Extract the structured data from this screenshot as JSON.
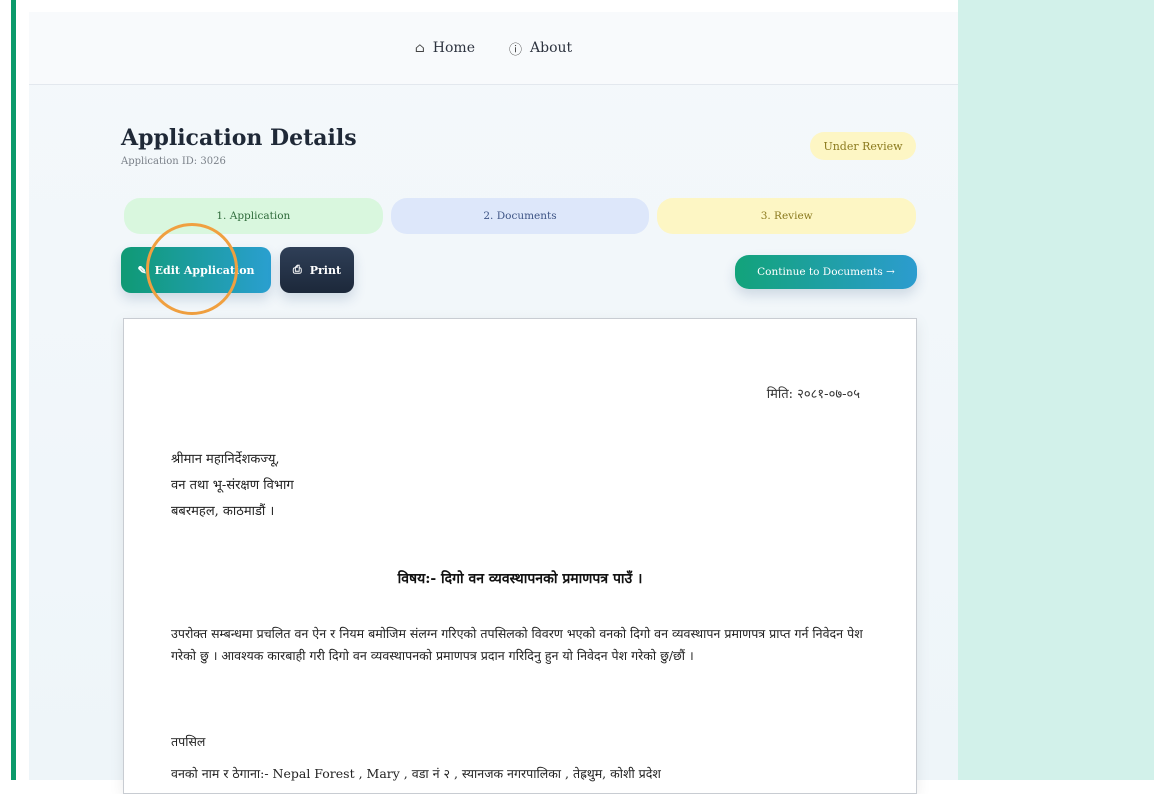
{
  "nav": {
    "home_icon": "home-icon",
    "home_label": "Home",
    "about_icon": "info-icon",
    "about_label": "About"
  },
  "header": {
    "title": "Application Details",
    "app_id": "Application ID: 3026",
    "status": "Under Review"
  },
  "steps": [
    {
      "label": "1. Application"
    },
    {
      "label": "2. Documents"
    },
    {
      "label": "3. Review"
    }
  ],
  "actions": {
    "edit_label": "Edit Application",
    "print_label": "Print",
    "continue_label": "Continue to Documents →"
  },
  "document": {
    "date": "मिति: २०८१-०७-०५",
    "address_lines": [
      "श्रीमान महानिर्देशकज्यू,",
      "वन तथा भू-संरक्षण विभाग",
      "बबरमहल, काठमाडौं ।"
    ],
    "subject": "विषय:- दिगो वन व्यवस्थापनको प्रमाणपत्र पाउँ ।",
    "body": "उपरोक्त सम्बन्धमा प्रचलित वन ऐन र नियम बमोजिम संलग्न गरिएको तपसिलको विवरण भएको वनको दिगो वन व्यवस्थापन प्रमाणपत्र प्राप्त गर्न निवेदन पेश गरेको छु । आवश्यक कारबाही गरी दिगो वन व्यवस्थापनको प्रमाणपत्र प्रदान गरिदिनु हुन यो निवेदन पेश गरेको छु/छौं ।",
    "tapsil": "तपसिल",
    "forest_line": "वनको नाम र ठेगाना:- Nepal Forest , Mary , वडा नं २ , स्यानजक नगरपालिका , तेह्रथुम, कोशी प्रदेश"
  },
  "colors": {
    "accent_green": "#0b9a6a",
    "right_panel": "#d2f1ea",
    "status_badge": "#fdf6c4"
  }
}
